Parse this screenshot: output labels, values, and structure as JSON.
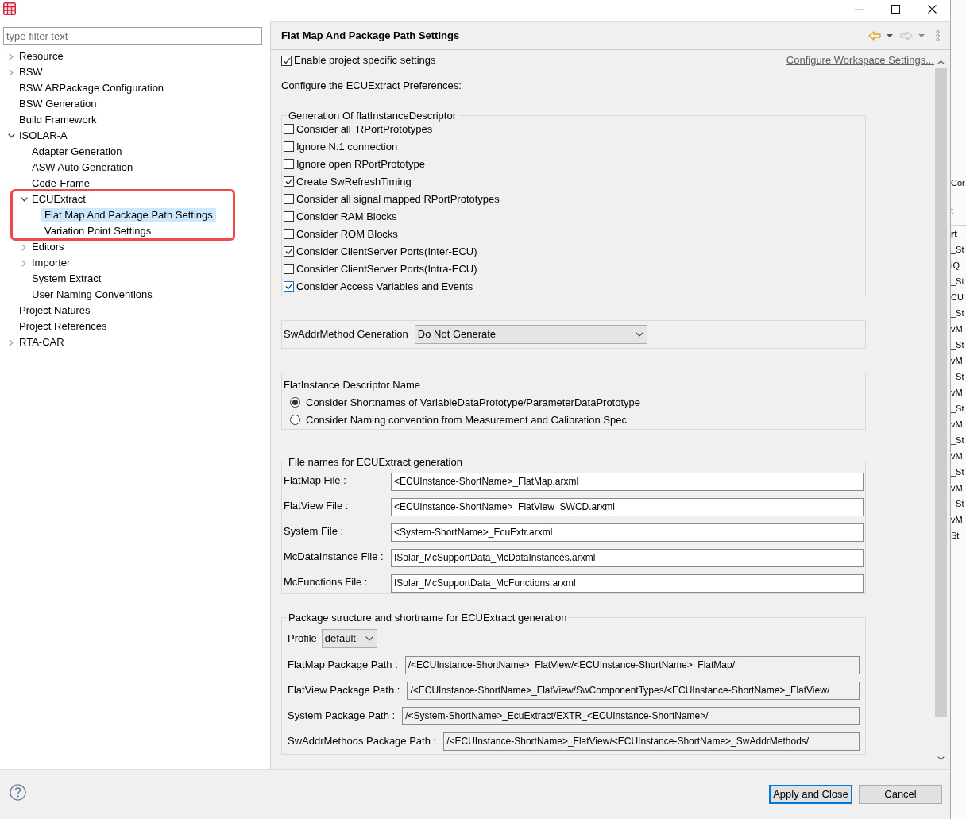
{
  "window": {
    "controls": [
      {
        "kind": "minimize",
        "disabled": true
      },
      {
        "kind": "maximize",
        "disabled": false
      },
      {
        "kind": "close",
        "disabled": false
      }
    ]
  },
  "filter": {
    "placeholder": "type filter text"
  },
  "tree": [
    {
      "label": "Resource",
      "kind": "group",
      "expanded": false,
      "selected": false,
      "annotated": false
    },
    {
      "label": "BSW",
      "kind": "group",
      "expanded": false,
      "selected": false,
      "annotated": false
    },
    {
      "label": "BSW ARPackage Configuration",
      "kind": "page",
      "selected": false,
      "annotated": false
    },
    {
      "label": "BSW Generation",
      "kind": "page",
      "selected": false,
      "annotated": false
    },
    {
      "label": "Build Framework",
      "kind": "page",
      "selected": false,
      "annotated": false
    },
    {
      "label": "ISOLAR-A",
      "kind": "group",
      "expanded": true,
      "selected": false,
      "annotated": false,
      "children": [
        {
          "label": "Adapter Generation",
          "kind": "page",
          "selected": false,
          "annotated": false
        },
        {
          "label": "ASW Auto Generation",
          "kind": "page",
          "selected": false,
          "annotated": false
        },
        {
          "label": "Code-Frame",
          "kind": "page",
          "selected": false,
          "annotated": false
        },
        {
          "label": "ECUExtract",
          "kind": "group",
          "expanded": true,
          "selected": false,
          "annotated": true,
          "children": [
            {
              "label": "Flat Map And Package Path Settings",
              "kind": "page",
              "selected": true,
              "annotated": false
            },
            {
              "label": "Variation Point Settings",
              "kind": "page",
              "selected": false,
              "annotated": false
            }
          ]
        },
        {
          "label": "Editors",
          "kind": "group",
          "expanded": false,
          "selected": false,
          "annotated": false
        },
        {
          "label": "Importer",
          "kind": "group",
          "expanded": false,
          "selected": false,
          "annotated": false
        },
        {
          "label": "System Extract",
          "kind": "page",
          "selected": false,
          "annotated": false
        },
        {
          "label": "User Naming Conventions",
          "kind": "page",
          "selected": false,
          "annotated": false
        }
      ]
    },
    {
      "label": "Project Natures",
      "kind": "page",
      "selected": false,
      "annotated": false
    },
    {
      "label": "Project References",
      "kind": "page",
      "selected": false,
      "annotated": false
    },
    {
      "label": "RTA-CAR",
      "kind": "group",
      "expanded": false,
      "selected": false,
      "annotated": false
    }
  ],
  "page": {
    "title": "Flat Map And Package Path Settings",
    "history": [
      {
        "kind": "back",
        "disabled": false
      },
      {
        "kind": "forward",
        "disabled": true
      }
    ]
  },
  "project_settings": {
    "label": "Enable project specific settings",
    "checked": true,
    "link": "Configure Workspace Settings..."
  },
  "intro": "Configure the ECUExtract Preferences:",
  "descriptor_group": {
    "title": "Generation Of flatInstanceDescriptor",
    "options": [
      {
        "label": "Consider all  RPortPrototypes",
        "checked": false,
        "focused": false
      },
      {
        "label": "Ignore N:1 connection",
        "checked": false,
        "focused": false
      },
      {
        "label": "Ignore open RPortPrototype",
        "checked": false,
        "focused": false
      },
      {
        "label": "Create SwRefreshTiming",
        "checked": true,
        "focused": false
      },
      {
        "label": "Consider all signal mapped RPortPrototypes",
        "checked": false,
        "focused": false
      },
      {
        "label": "Consider RAM Blocks",
        "checked": false,
        "focused": false
      },
      {
        "label": "Consider ROM Blocks",
        "checked": false,
        "focused": false
      },
      {
        "label": "Consider ClientServer Ports(Inter-ECU)",
        "checked": true,
        "focused": false
      },
      {
        "label": "Consider ClientServer Ports(Intra-ECU)",
        "checked": false,
        "focused": false
      },
      {
        "label": "Consider Access Variables and Events",
        "checked": true,
        "focused": true
      }
    ]
  },
  "swaddr": {
    "label": "SwAddrMethod Generation",
    "value": "Do Not Generate"
  },
  "name_group": {
    "title": "FlatInstance Descriptor Name",
    "options": [
      {
        "label": "Consider Shortnames of VariableDataPrototype/ParameterDataPrototype",
        "selected": true
      },
      {
        "label": "Consider Naming convention from Measurement and Calibration Spec",
        "selected": false
      }
    ]
  },
  "file_group": {
    "title": "File names for ECUExtract generation",
    "fields": [
      {
        "label": "FlatMap File :",
        "value": "<ECUInstance-ShortName>_FlatMap.arxml",
        "read_only": false
      },
      {
        "label": "FlatView File :",
        "value": "<ECUInstance-ShortName>_FlatView_SWCD.arxml",
        "read_only": false
      },
      {
        "label": "System File :",
        "value": "<System-ShortName>_EcuExtr.arxml",
        "read_only": false
      },
      {
        "label": "McDataInstance File :",
        "value": "ISolar_McSupportData_McDataInstances.arxml",
        "read_only": false
      },
      {
        "label": "McFunctions File :",
        "value": "ISolar_McSupportData_McFunctions.arxml",
        "read_only": false
      }
    ]
  },
  "package_group": {
    "title": "Package structure and shortname for ECUExtract generation",
    "profile": {
      "label": "Profile",
      "value": "default"
    },
    "fields": [
      {
        "label": "FlatMap Package Path :",
        "value": "/<ECUInstance-ShortName>_FlatView/<ECUInstance-ShortName>_FlatMap/",
        "read_only": true
      },
      {
        "label": "FlatView Package Path :",
        "value": "/<ECUInstance-ShortName>_FlatView/SwComponentTypes/<ECUInstance-ShortName>_FlatView/",
        "read_only": true
      },
      {
        "label": "System Package Path :",
        "value": "/<System-ShortName>_EcuExtract/EXTR_<ECUInstance-ShortName>/",
        "read_only": true
      },
      {
        "label": "SwAddrMethods Package Path :",
        "value": "/<ECUInstance-ShortName>_FlatView/<ECUInstance-ShortName>_SwAddrMethods/",
        "read_only": true
      }
    ]
  },
  "buttons": [
    {
      "label": "Apply and Close",
      "default": true
    },
    {
      "label": "Cancel",
      "default": false
    }
  ],
  "background_window": {
    "fragments": [
      {
        "text": "Cor",
        "kind": "label"
      },
      {
        "text": "t",
        "kind": "hint"
      },
      {
        "text": "rt",
        "kind": "header"
      },
      {
        "text": "_St",
        "kind": "cell"
      },
      {
        "text": "iQ",
        "kind": "cell"
      },
      {
        "text": "_St",
        "kind": "cell"
      },
      {
        "text": "CU",
        "kind": "cell"
      },
      {
        "text": "_St",
        "kind": "cell"
      },
      {
        "text": "vM",
        "kind": "cell"
      },
      {
        "text": "_St",
        "kind": "cell"
      },
      {
        "text": "vM",
        "kind": "cell"
      },
      {
        "text": "_St",
        "kind": "cell"
      },
      {
        "text": "vM",
        "kind": "cell"
      },
      {
        "text": "_St",
        "kind": "cell"
      },
      {
        "text": "vM",
        "kind": "cell"
      },
      {
        "text": "_St",
        "kind": "cell"
      },
      {
        "text": "vM",
        "kind": "cell"
      },
      {
        "text": "_St",
        "kind": "cell"
      },
      {
        "text": "vM",
        "kind": "cell"
      },
      {
        "text": "_St",
        "kind": "cell"
      },
      {
        "text": "vM",
        "kind": "cell"
      },
      {
        "text": "St",
        "kind": "cell"
      }
    ]
  }
}
